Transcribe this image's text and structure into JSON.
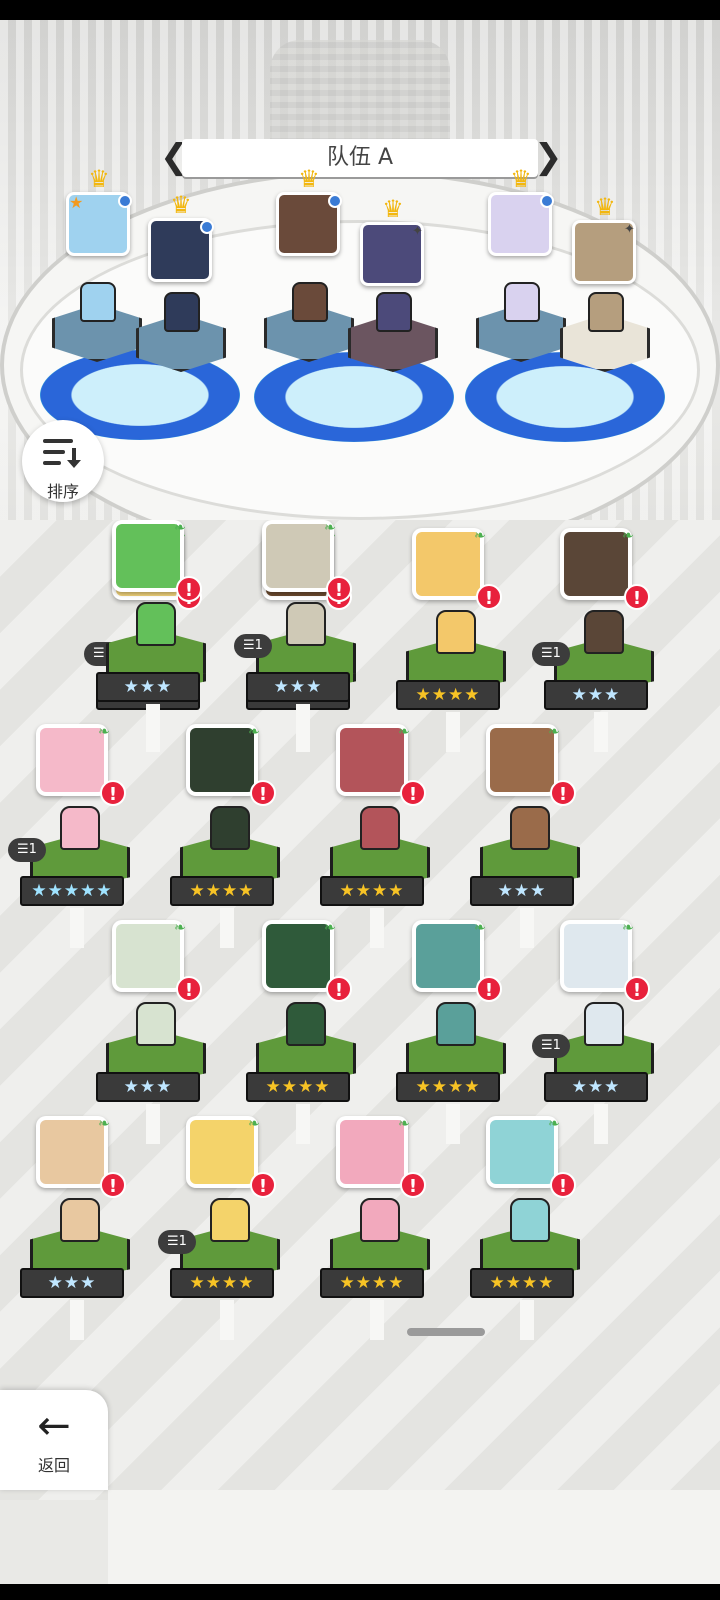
{
  "team": {
    "name": "队伍 A"
  },
  "sort_button": {
    "label": "排序"
  },
  "back_button": {
    "label": "返回"
  },
  "formation": [
    {
      "slot": 1,
      "portrait_color": "#9fd2ef",
      "block": "blue",
      "leader_star": true,
      "badge": "blue"
    },
    {
      "slot": 2,
      "portrait_color": "#2f3b5a",
      "block": "blue",
      "badge": "blue"
    },
    {
      "slot": 3,
      "portrait_color": "#6a4a3a",
      "block": "blue",
      "badge": "blue"
    },
    {
      "slot": 4,
      "portrait_color": "#4c4a7a",
      "block": "purple",
      "badge": "sparkle"
    },
    {
      "slot": 5,
      "portrait_color": "#d9d2ef",
      "block": "blue",
      "badge": "blue"
    },
    {
      "slot": 6,
      "portrait_color": "#b59e7e",
      "block": "cream",
      "badge": "sparkle"
    }
  ],
  "heroes": [
    {
      "face": "#f0d27a",
      "stars": "★★★★",
      "rarity": "gold",
      "dup": "1"
    },
    {
      "face": "#6b4a2e",
      "stars": "★★★★",
      "rarity": "gold"
    },
    {
      "face": "#f3c86a",
      "stars": "★★★★",
      "rarity": "gold"
    },
    {
      "face": "#5a4637",
      "stars": "★★★",
      "rarity": "blue",
      "dup": "1"
    },
    {
      "face": "#f5b9c9",
      "stars": "★★★★★",
      "rarity": "rainbow",
      "dup": "1"
    },
    {
      "face": "#2f3f2f",
      "stars": "★★★★",
      "rarity": "gold"
    },
    {
      "face": "#b3545a",
      "stars": "★★★★",
      "rarity": "gold"
    },
    {
      "face": "#9a6b4a",
      "stars": "★★★",
      "rarity": "blue"
    },
    {
      "face": "#d7e3d0",
      "stars": "★★★",
      "rarity": "blue"
    },
    {
      "face": "#2f5a3a",
      "stars": "★★★★",
      "rarity": "gold"
    },
    {
      "face": "#5aa09a",
      "stars": "★★★★",
      "rarity": "gold"
    },
    {
      "face": "#dfe8ee",
      "stars": "★★★",
      "rarity": "blue",
      "dup": "1"
    },
    {
      "face": "#e8c8a0",
      "stars": "★★★",
      "rarity": "blue"
    },
    {
      "face": "#f4d36a",
      "stars": "★★★★",
      "rarity": "gold",
      "dup": "1"
    },
    {
      "face": "#f2a9bd",
      "stars": "★★★★",
      "rarity": "gold"
    },
    {
      "face": "#8fd3d6",
      "stars": "★★★★",
      "rarity": "gold"
    },
    {
      "face": "#63c05a",
      "stars": "★★★",
      "rarity": "blue"
    },
    {
      "face": "#cfc9b6",
      "stars": "★★★",
      "rarity": "blue",
      "dup": "1"
    }
  ]
}
